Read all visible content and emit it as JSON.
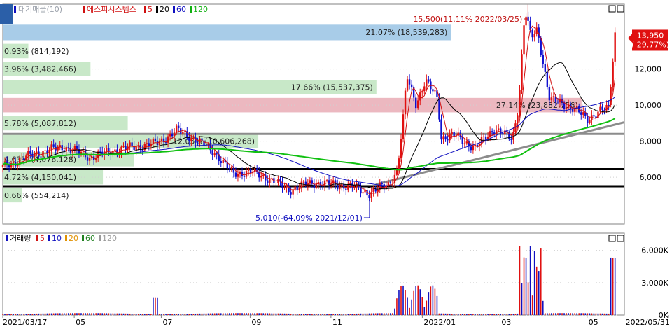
{
  "chart_data": [
    {
      "type": "candlestick",
      "panel": "price",
      "legend": [
        {
          "text": "대기매물(10)",
          "color": "#9aa0aa"
        },
        {
          "text": "에스피시스템스",
          "color": "#d01010"
        },
        {
          "text": "5",
          "color": "#d01010"
        },
        {
          "text": "20",
          "color": "#000000"
        },
        {
          "text": "60",
          "color": "#1010c0"
        },
        {
          "text": "120",
          "color": "#10b010"
        }
      ],
      "y_ticks": [
        "12,000",
        "10,000",
        "8,000",
        "6,000"
      ],
      "y_tick_values": [
        12000,
        10000,
        8000,
        6000
      ],
      "ylim": [
        3400,
        15600
      ],
      "current_price": {
        "value": 13950,
        "label": "13,950",
        "change": "( 29.77%)"
      },
      "annotations": {
        "high": "15,500(11.11% 2022/03/25)",
        "low": "5,010(-64.09% 2021/12/01)"
      },
      "volume_profile": [
        {
          "label": "21.07% (18,539,283)",
          "price_low": 13600,
          "price_high": 14500,
          "length": 0.72,
          "color": "#a8cce8"
        },
        {
          "label": "0.93% (814,192)",
          "price_low": 12600,
          "price_high": 13400,
          "length": 0.04,
          "color": "#c8e8c8"
        },
        {
          "label": "3.96% (3,482,466)",
          "price_low": 11600,
          "price_high": 12400,
          "length": 0.14,
          "color": "#c8e8c8"
        },
        {
          "label": "17.66% (15,537,375)",
          "price_low": 10600,
          "price_high": 11400,
          "length": 0.6,
          "color": "#c8e8c8"
        },
        {
          "label": "27.14% (23,882,756)",
          "price_low": 9600,
          "price_high": 10400,
          "length": 0.93,
          "color": "#ecb8c0"
        },
        {
          "label": "5.78% (5,087,812)",
          "price_low": 8600,
          "price_high": 9400,
          "length": 0.2,
          "color": "#c8e8c8"
        },
        {
          "label": "12.05% (10,606,268)",
          "price_low": 7600,
          "price_high": 8400,
          "length": 0.41,
          "color": "#c8e8c8"
        },
        {
          "label": "4.63% (4,076,128)",
          "price_low": 6600,
          "price_high": 7400,
          "length": 0.21,
          "color": "#c8e8c8"
        },
        {
          "label": "4.72% (4,150,041)",
          "price_low": 5600,
          "price_high": 6400,
          "length": 0.16,
          "color": "#c8e8c8"
        },
        {
          "label": "0.66% (554,214)",
          "price_low": 4600,
          "price_high": 5400,
          "length": 0.03,
          "color": "#c8e8c8"
        }
      ],
      "support_lines": [
        6450,
        5500,
        8400
      ],
      "trendline": {
        "from": {
          "x": 0.6,
          "y": 5600
        },
        "to": {
          "x": 1.0,
          "y": 9050
        }
      },
      "start_price": 6550
    },
    {
      "type": "bar",
      "panel": "volume",
      "legend": [
        {
          "text": "거래량",
          "color": "#000000"
        },
        {
          "text": "5",
          "color": "#d01010"
        },
        {
          "text": "10",
          "color": "#1010c0"
        },
        {
          "text": "20",
          "color": "#e09000"
        },
        {
          "text": "60",
          "color": "#208020"
        },
        {
          "text": "120",
          "color": "#9a9a9a"
        }
      ],
      "y_ticks": [
        "6,000K",
        "3,000K",
        "0K"
      ],
      "y_tick_values": [
        6000,
        3000,
        0
      ],
      "ylim": [
        0,
        7600
      ]
    }
  ],
  "x_axis": {
    "labels": [
      {
        "text": "2021/03/17",
        "pos": 0.0
      },
      {
        "text": "05",
        "pos": 0.115
      },
      {
        "text": "07",
        "pos": 0.255
      },
      {
        "text": "09",
        "pos": 0.398
      },
      {
        "text": "11",
        "pos": 0.528
      },
      {
        "text": "2022/01",
        "pos": 0.675
      },
      {
        "text": "03",
        "pos": 0.8
      },
      {
        "text": "05",
        "pos": 0.94
      },
      {
        "text": "2022/05/31",
        "pos": 1.0
      }
    ]
  }
}
